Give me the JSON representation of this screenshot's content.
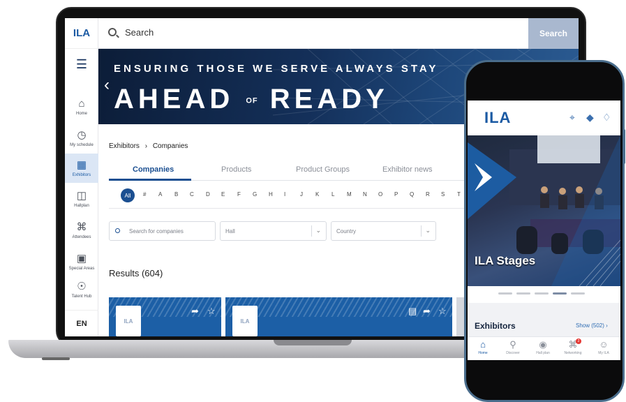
{
  "laptop": {
    "logo": "ILA",
    "sidebar": {
      "menu_icon": "hamburger-icon",
      "items": [
        {
          "label": "Home",
          "icon": "home-icon"
        },
        {
          "label": "My schedule",
          "icon": "schedule-icon"
        },
        {
          "label": "Exhibitors",
          "icon": "exhibitors-icon",
          "active": true
        },
        {
          "label": "Hallplan",
          "icon": "map-icon"
        },
        {
          "label": "Attendees",
          "icon": "attendees-icon"
        },
        {
          "label": "Special Areas",
          "icon": "special-areas-icon"
        },
        {
          "label": "Talent Hub",
          "icon": "talent-hub-icon"
        }
      ],
      "language": "EN"
    },
    "search": {
      "placeholder": "Search",
      "button": "Search"
    },
    "banner": {
      "line1": "ENSURING THOSE WE SERVE ALWAYS STAY",
      "line2a": "AHEAD",
      "line2of": "OF",
      "line2b": "READY"
    },
    "breadcrumb": {
      "parent": "Exhibitors",
      "separator": "›",
      "current": "Companies"
    },
    "tabs": [
      {
        "label": "Companies",
        "active": true
      },
      {
        "label": "Products"
      },
      {
        "label": "Product Groups"
      },
      {
        "label": "Exhibitor news"
      }
    ],
    "alphabet": {
      "all": "All",
      "letters": [
        "#",
        "A",
        "B",
        "C",
        "D",
        "E",
        "F",
        "G",
        "H",
        "I",
        "J",
        "K",
        "L",
        "M",
        "N",
        "O",
        "P",
        "Q",
        "R",
        "S",
        "T"
      ]
    },
    "filters": {
      "search_placeholder": "Search for companies",
      "hall_placeholder": "Hall",
      "country_placeholder": "Country"
    },
    "results": "Results (604)",
    "cards": [
      {
        "logo": "ILA",
        "icons": [
          "share-icon",
          "star-icon"
        ]
      },
      {
        "logo": "ILA",
        "icons": [
          "calendar-icon",
          "share-icon",
          "star-icon"
        ]
      }
    ],
    "colors": {
      "accent": "#1b4f91",
      "card": "#1c5fa6",
      "search_button": "#a9b8cf"
    }
  },
  "phone": {
    "logo": "ILA",
    "header_icons": [
      "qr-icon",
      "tag-icon",
      "bell-icon"
    ],
    "hero_title": "ILA Stages",
    "section_title": "Exhibitors",
    "show_link": "Show (502)",
    "nav": [
      {
        "label": "Home",
        "icon": "home-icon",
        "active": true
      },
      {
        "label": "Discover",
        "icon": "search-icon"
      },
      {
        "label": "Hall plan",
        "icon": "location-icon"
      },
      {
        "label": "Networking",
        "icon": "networking-icon",
        "badge": "2"
      },
      {
        "label": "My ILA",
        "icon": "user-icon"
      }
    ]
  }
}
